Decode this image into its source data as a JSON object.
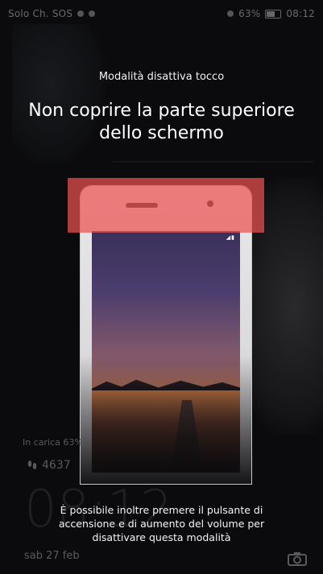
{
  "status_bar": {
    "carrier": "Solo Ch. SOS",
    "battery": "63%",
    "time": "08:12"
  },
  "modal": {
    "mode_title": "Modalità disattiva tocco",
    "headline": "Non coprire la parte superiore dello schermo",
    "tip": "È possibile inoltre premere il pulsante di accensione e di aumento del volume per disattivare questa modalità"
  },
  "lockscreen": {
    "charging": "In carica 63%",
    "steps": "4637",
    "clock": "08:12",
    "date": "sab 27 feb"
  },
  "colors": {
    "cover_zone": "#eb5050",
    "background": "#0b0b0d"
  },
  "icons": {
    "steps": "footsteps-icon",
    "camera": "camera-icon"
  }
}
